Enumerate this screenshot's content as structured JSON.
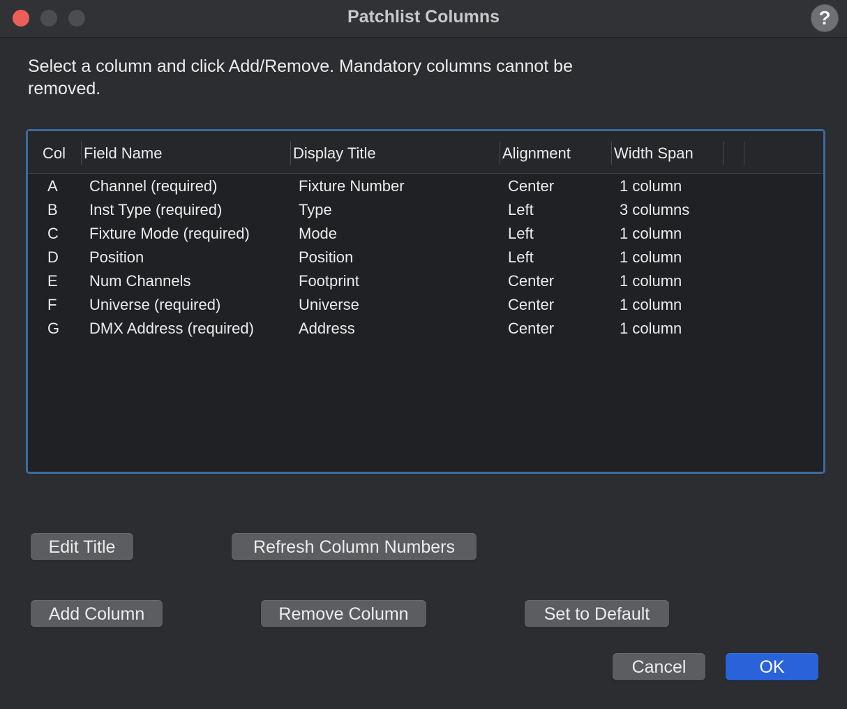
{
  "window": {
    "title": "Patchlist Columns",
    "help_label": "?"
  },
  "instructions": "Select a column and click Add/Remove. Mandatory columns cannot be removed.",
  "table": {
    "headers": [
      "Col",
      "Field Name",
      "Display Title",
      "Alignment",
      "Width Span"
    ],
    "rows": [
      {
        "col": "A",
        "field": "Channel (required)",
        "display": "Fixture Number",
        "align": "Center",
        "width": "1 column"
      },
      {
        "col": "B",
        "field": "Inst Type (required)",
        "display": "Type",
        "align": "Left",
        "width": "3 columns"
      },
      {
        "col": "C",
        "field": "Fixture Mode (required)",
        "display": "Mode",
        "align": "Left",
        "width": "1 column"
      },
      {
        "col": "D",
        "field": "Position",
        "display": "Position",
        "align": "Left",
        "width": "1 column"
      },
      {
        "col": "E",
        "field": "Num Channels",
        "display": "Footprint",
        "align": "Center",
        "width": "1 column"
      },
      {
        "col": "F",
        "field": "Universe (required)",
        "display": "Universe",
        "align": "Center",
        "width": "1 column"
      },
      {
        "col": "G",
        "field": "DMX Address (required)",
        "display": "Address",
        "align": "Center",
        "width": "1 column"
      }
    ]
  },
  "buttons": {
    "edit_title": "Edit Title",
    "refresh_columns": "Refresh Column Numbers",
    "add_column": "Add Column",
    "remove_column": "Remove Column",
    "set_default": "Set to Default",
    "cancel": "Cancel",
    "ok": "OK"
  },
  "colors": {
    "accent": "#2a63d9",
    "table_focus_border": "#3a6b9d",
    "close_button": "#ec5f59"
  }
}
